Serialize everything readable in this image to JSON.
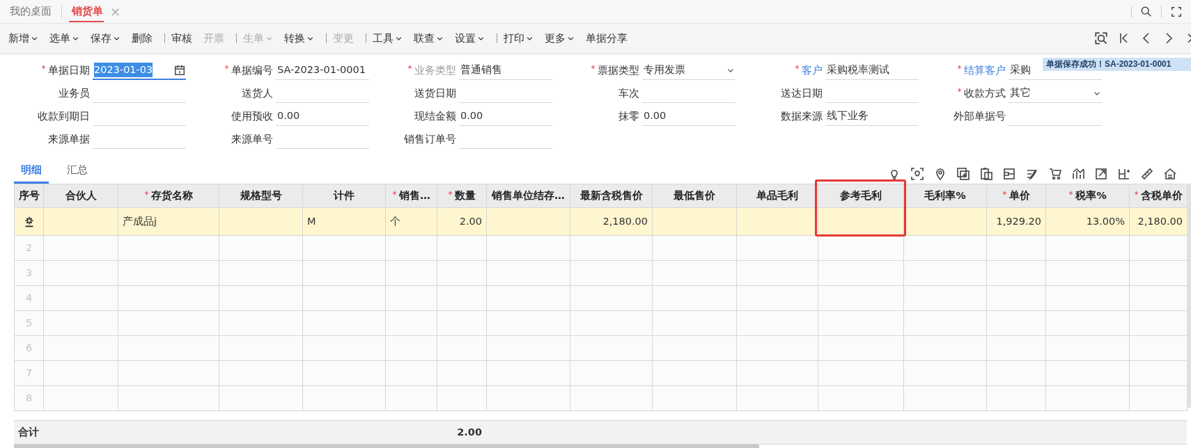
{
  "tabs": [
    {
      "label": "我的桌面",
      "selected": false
    },
    {
      "label": "销货单",
      "selected": true,
      "close_label": "×"
    }
  ],
  "toolbar": [
    {
      "label": "新增",
      "dropdown": true,
      "disabled": false,
      "separator_after": false
    },
    {
      "label": "选单",
      "dropdown": true,
      "disabled": false,
      "separator_after": false
    },
    {
      "label": "保存",
      "dropdown": true,
      "disabled": false,
      "separator_after": false
    },
    {
      "label": "删除",
      "dropdown": false,
      "disabled": false,
      "separator_after": true
    },
    {
      "label": "审核",
      "dropdown": false,
      "disabled": false,
      "separator_after": false
    },
    {
      "label": "开票",
      "dropdown": false,
      "disabled": true,
      "separator_after": true
    },
    {
      "label": "生单",
      "dropdown": true,
      "disabled": true,
      "separator_after": false
    },
    {
      "label": "转换",
      "dropdown": true,
      "disabled": false,
      "separator_after": true
    },
    {
      "label": "变更",
      "dropdown": false,
      "disabled": true,
      "separator_after": true
    },
    {
      "label": "工具",
      "dropdown": true,
      "disabled": false,
      "separator_after": false
    },
    {
      "label": "联查",
      "dropdown": true,
      "disabled": false,
      "separator_after": false
    },
    {
      "label": "设置",
      "dropdown": true,
      "disabled": false,
      "separator_after": true
    },
    {
      "label": "打印",
      "dropdown": true,
      "disabled": false,
      "separator_after": false
    },
    {
      "label": "更多",
      "dropdown": true,
      "disabled": false,
      "separator_after": false
    },
    {
      "label": "单据分享",
      "dropdown": false,
      "disabled": false,
      "separator_after": false
    }
  ],
  "toast": "单据保存成功！SA-2023-01-0001",
  "form": {
    "rows": [
      [
        {
          "label": "单据日期",
          "required": true,
          "link": false,
          "disabled": false,
          "kind": "date",
          "value": "2023-01-03",
          "focused": true
        },
        {
          "label": "单据编号",
          "required": true,
          "link": false,
          "disabled": false,
          "kind": "text",
          "value": "SA-2023-01-0001",
          "focused": false
        },
        {
          "label": "业务类型",
          "required": true,
          "link": false,
          "disabled": true,
          "kind": "text",
          "value": "普通销售",
          "focused": false
        },
        {
          "label": "票据类型",
          "required": true,
          "link": false,
          "disabled": false,
          "kind": "select",
          "value": "专用发票",
          "focused": false
        },
        {
          "label": "客户",
          "required": true,
          "link": true,
          "disabled": false,
          "kind": "text",
          "value": "采购税率测试",
          "focused": false
        },
        {
          "label": "结算客户",
          "required": true,
          "link": true,
          "disabled": false,
          "kind": "text",
          "value": "采购",
          "focused": false
        }
      ],
      [
        {
          "label": "业务员",
          "required": false,
          "link": false,
          "disabled": false,
          "kind": "text",
          "focused": false
        },
        {
          "label": "送货人",
          "required": false,
          "link": false,
          "disabled": false,
          "kind": "text",
          "focused": false
        },
        {
          "label": "送货日期",
          "required": false,
          "link": false,
          "disabled": false,
          "kind": "text",
          "focused": false
        },
        {
          "label": "车次",
          "required": false,
          "link": false,
          "disabled": false,
          "kind": "text",
          "focused": false
        },
        {
          "label": "送达日期",
          "required": false,
          "link": false,
          "disabled": false,
          "kind": "text",
          "focused": false
        },
        {
          "label": "收款方式",
          "required": true,
          "link": false,
          "disabled": false,
          "kind": "select",
          "value": "其它",
          "focused": false
        }
      ],
      [
        {
          "label": "收款到期日",
          "required": false,
          "link": false,
          "disabled": false,
          "kind": "text",
          "focused": false
        },
        {
          "label": "使用预收",
          "required": false,
          "link": false,
          "disabled": false,
          "kind": "text",
          "value": "0.00",
          "focused": false
        },
        {
          "label": "现结金额",
          "required": false,
          "link": false,
          "disabled": false,
          "kind": "text",
          "value": "0.00",
          "focused": false
        },
        {
          "label": "抹零",
          "required": false,
          "link": false,
          "disabled": false,
          "kind": "text",
          "value": "0.00",
          "focused": false
        },
        {
          "label": "数据来源",
          "required": false,
          "link": false,
          "disabled": false,
          "kind": "text",
          "value": "线下业务",
          "focused": false
        },
        {
          "label": "外部单据号",
          "required": false,
          "link": false,
          "disabled": false,
          "kind": "text",
          "focused": false
        }
      ],
      [
        {
          "label": "来源单据",
          "required": false,
          "link": false,
          "disabled": false,
          "kind": "text",
          "focused": false
        },
        {
          "label": "来源单号",
          "required": false,
          "link": false,
          "disabled": false,
          "kind": "text",
          "focused": false
        },
        {
          "label": "销售订单号",
          "required": false,
          "link": false,
          "disabled": false,
          "kind": "text",
          "focused": false
        }
      ]
    ]
  },
  "detail_tabs": [
    {
      "label": "明细",
      "selected": true
    },
    {
      "label": "汇总",
      "selected": false
    }
  ],
  "table": {
    "columns": [
      {
        "label": "序号",
        "required": false,
        "kind": "text",
        "highlighted": false
      },
      {
        "label": "合伙人",
        "required": false,
        "kind": "text",
        "highlighted": false
      },
      {
        "label": "存货名称",
        "required": true,
        "kind": "text",
        "highlighted": false
      },
      {
        "label": "规格型号",
        "required": false,
        "kind": "text",
        "highlighted": false
      },
      {
        "label": "计件",
        "required": false,
        "kind": "text",
        "highlighted": false
      },
      {
        "label": "销售…",
        "required": true,
        "kind": "text",
        "highlighted": false
      },
      {
        "label": "数量",
        "required": true,
        "kind": "number",
        "highlighted": false
      },
      {
        "label": "销售单位结存…",
        "required": false,
        "kind": "number",
        "highlighted": false
      },
      {
        "label": "最新含税售价",
        "required": false,
        "kind": "number",
        "highlighted": false
      },
      {
        "label": "最低售价",
        "required": false,
        "kind": "number",
        "highlighted": false
      },
      {
        "label": "单品毛利",
        "required": false,
        "kind": "number",
        "highlighted": false
      },
      {
        "label": "参考毛利",
        "required": false,
        "kind": "number",
        "highlighted": true
      },
      {
        "label": "毛利率%",
        "required": false,
        "kind": "number",
        "highlighted": false
      },
      {
        "label": "单价",
        "required": true,
        "kind": "number",
        "highlighted": false
      },
      {
        "label": "税率%",
        "required": true,
        "kind": "number",
        "highlighted": false
      },
      {
        "label": "含税单价",
        "required": true,
        "kind": "number",
        "highlighted": false
      }
    ],
    "rows": [
      {
        "selected": true,
        "item_name": "产成品j",
        "count_unit": "M",
        "sales_unit": "个",
        "quantity": "2.00",
        "latest_tax_price": "2,180.00",
        "unit_price": "1,929.20",
        "tax_rate": "13.00%",
        "tax_unit_price": "2,180.00"
      },
      {
        "no": "2",
        "selected": false
      },
      {
        "no": "3",
        "selected": false
      },
      {
        "no": "4",
        "selected": false
      },
      {
        "no": "5",
        "selected": false
      },
      {
        "no": "6",
        "selected": false
      },
      {
        "no": "7",
        "selected": false
      },
      {
        "no": "8",
        "selected": false
      }
    ],
    "footer": {
      "label": "合计",
      "quantity": "2.00"
    }
  }
}
